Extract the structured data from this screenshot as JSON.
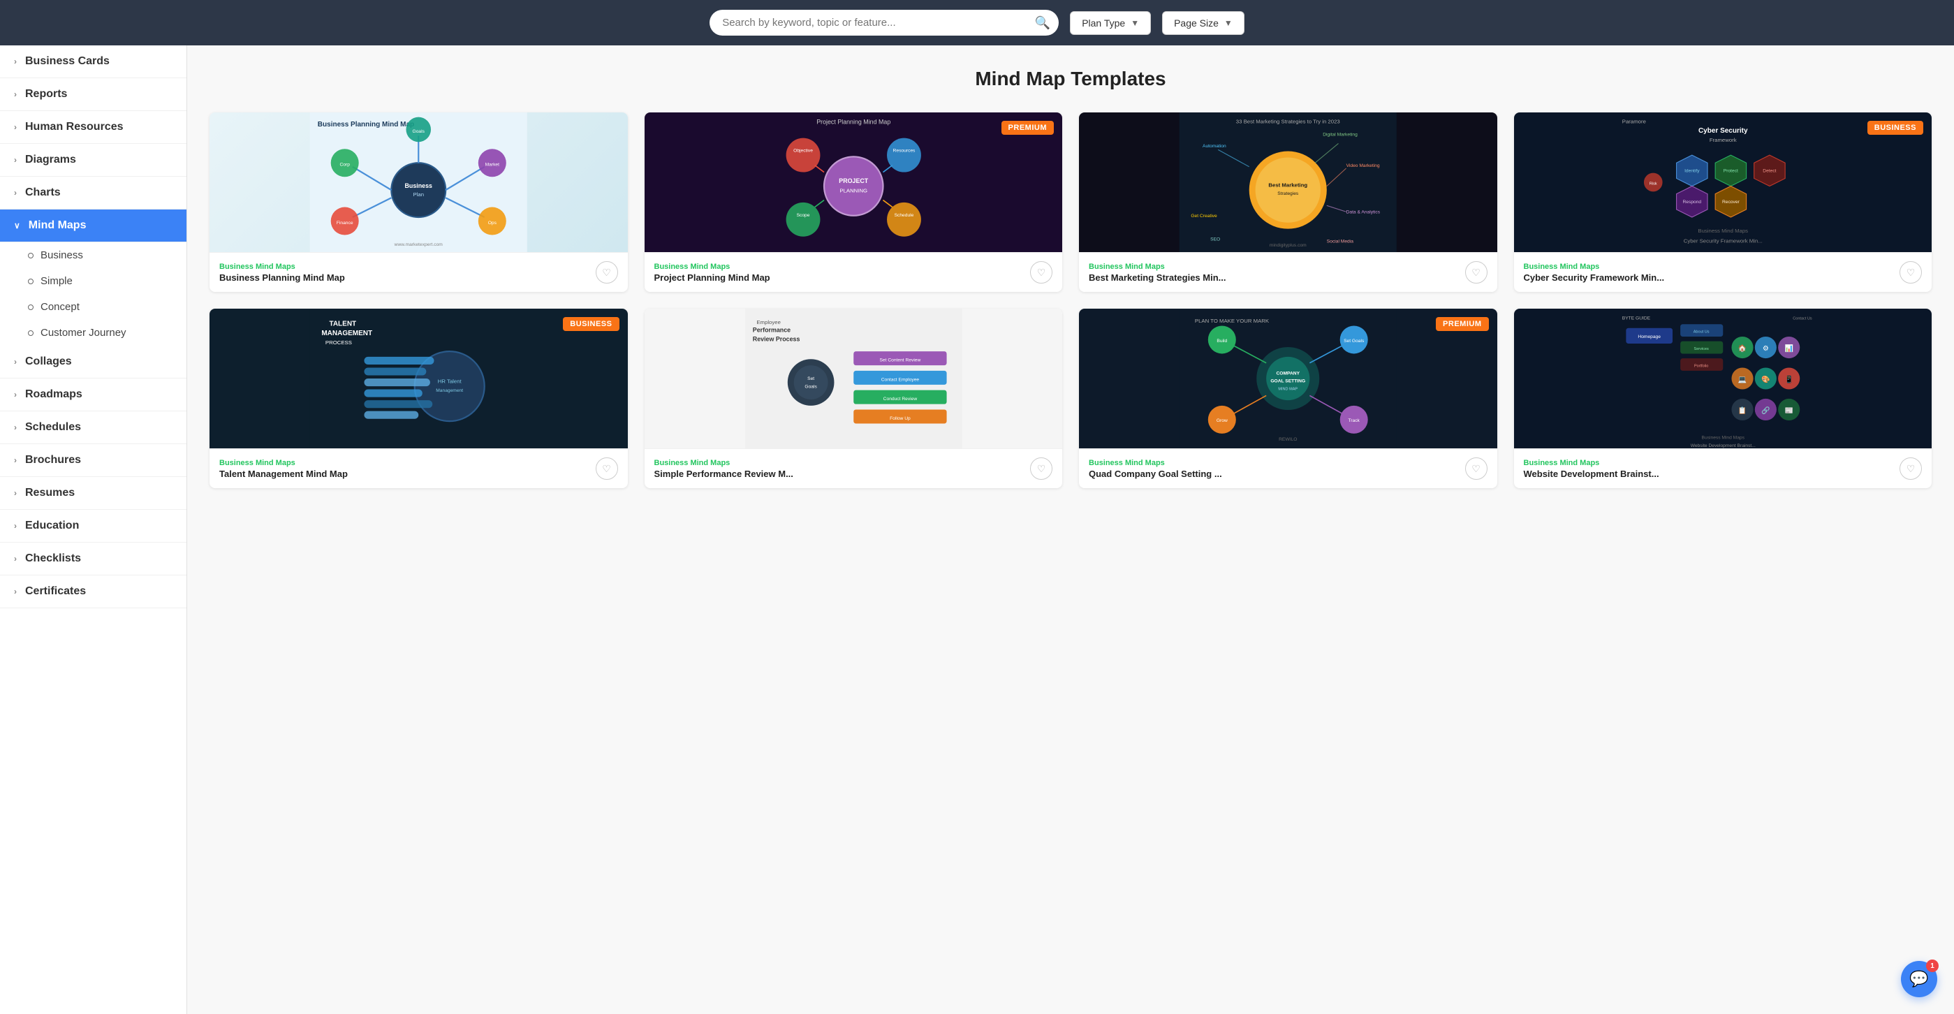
{
  "topbar": {
    "search_placeholder": "Search by keyword, topic or feature...",
    "plan_type_label": "Plan Type",
    "page_size_label": "Page Size"
  },
  "sidebar": {
    "items": [
      {
        "id": "business-cards",
        "label": "Business Cards",
        "expanded": false,
        "active": false
      },
      {
        "id": "reports",
        "label": "Reports",
        "expanded": false,
        "active": false
      },
      {
        "id": "human-resources",
        "label": "Human Resources",
        "expanded": false,
        "active": false
      },
      {
        "id": "diagrams",
        "label": "Diagrams",
        "expanded": false,
        "active": false
      },
      {
        "id": "charts",
        "label": "Charts",
        "expanded": false,
        "active": false
      },
      {
        "id": "mind-maps",
        "label": "Mind Maps",
        "expanded": true,
        "active": true
      },
      {
        "id": "collages",
        "label": "Collages",
        "expanded": false,
        "active": false
      },
      {
        "id": "roadmaps",
        "label": "Roadmaps",
        "expanded": false,
        "active": false
      },
      {
        "id": "schedules",
        "label": "Schedules",
        "expanded": false,
        "active": false
      },
      {
        "id": "brochures",
        "label": "Brochures",
        "expanded": false,
        "active": false
      },
      {
        "id": "resumes",
        "label": "Resumes",
        "expanded": false,
        "active": false
      },
      {
        "id": "education",
        "label": "Education",
        "expanded": false,
        "active": false
      },
      {
        "id": "checklists",
        "label": "Checklists",
        "expanded": false,
        "active": false
      },
      {
        "id": "certificates",
        "label": "Certificates",
        "expanded": false,
        "active": false
      }
    ],
    "sub_items": [
      {
        "id": "business",
        "label": "Business"
      },
      {
        "id": "simple",
        "label": "Simple"
      },
      {
        "id": "concept",
        "label": "Concept"
      },
      {
        "id": "customer-journey",
        "label": "Customer Journey"
      }
    ]
  },
  "page": {
    "title": "Mind Map Templates"
  },
  "templates": [
    {
      "id": "business-planning",
      "category": "Business Mind Maps",
      "name": "Business Planning Mind Map",
      "badge": null,
      "img_type": "business-planning"
    },
    {
      "id": "project-planning",
      "category": "Business Mind Maps",
      "name": "Project Planning Mind Map",
      "badge": "PREMIUM",
      "badge_type": "premium",
      "img_type": "project-planning"
    },
    {
      "id": "marketing-strategies",
      "category": "Business Mind Maps",
      "name": "Best Marketing Strategies Min...",
      "badge": null,
      "img_type": "marketing-strategies"
    },
    {
      "id": "cyber-security",
      "category": "Business Mind Maps",
      "name": "Cyber Security Framework Min...",
      "badge": "BUSINESS",
      "badge_type": "business",
      "img_type": "cyber-security"
    },
    {
      "id": "talent-management",
      "category": "Business Mind Maps",
      "name": "Talent Management Mind Map",
      "badge": "BUSINESS",
      "badge_type": "business",
      "img_type": "talent-management"
    },
    {
      "id": "performance-review",
      "category": "Business Mind Maps",
      "name": "Simple Performance Review M...",
      "badge": null,
      "img_type": "performance-review"
    },
    {
      "id": "company-goal",
      "category": "Business Mind Maps",
      "name": "Quad Company Goal Setting ...",
      "badge": "PREMIUM",
      "badge_type": "premium",
      "img_type": "company-goal"
    },
    {
      "id": "website-dev",
      "category": "Business Mind Maps",
      "name": "Website Development Brainst...",
      "badge": null,
      "img_type": "website-dev"
    }
  ],
  "chat": {
    "badge_count": "1"
  }
}
